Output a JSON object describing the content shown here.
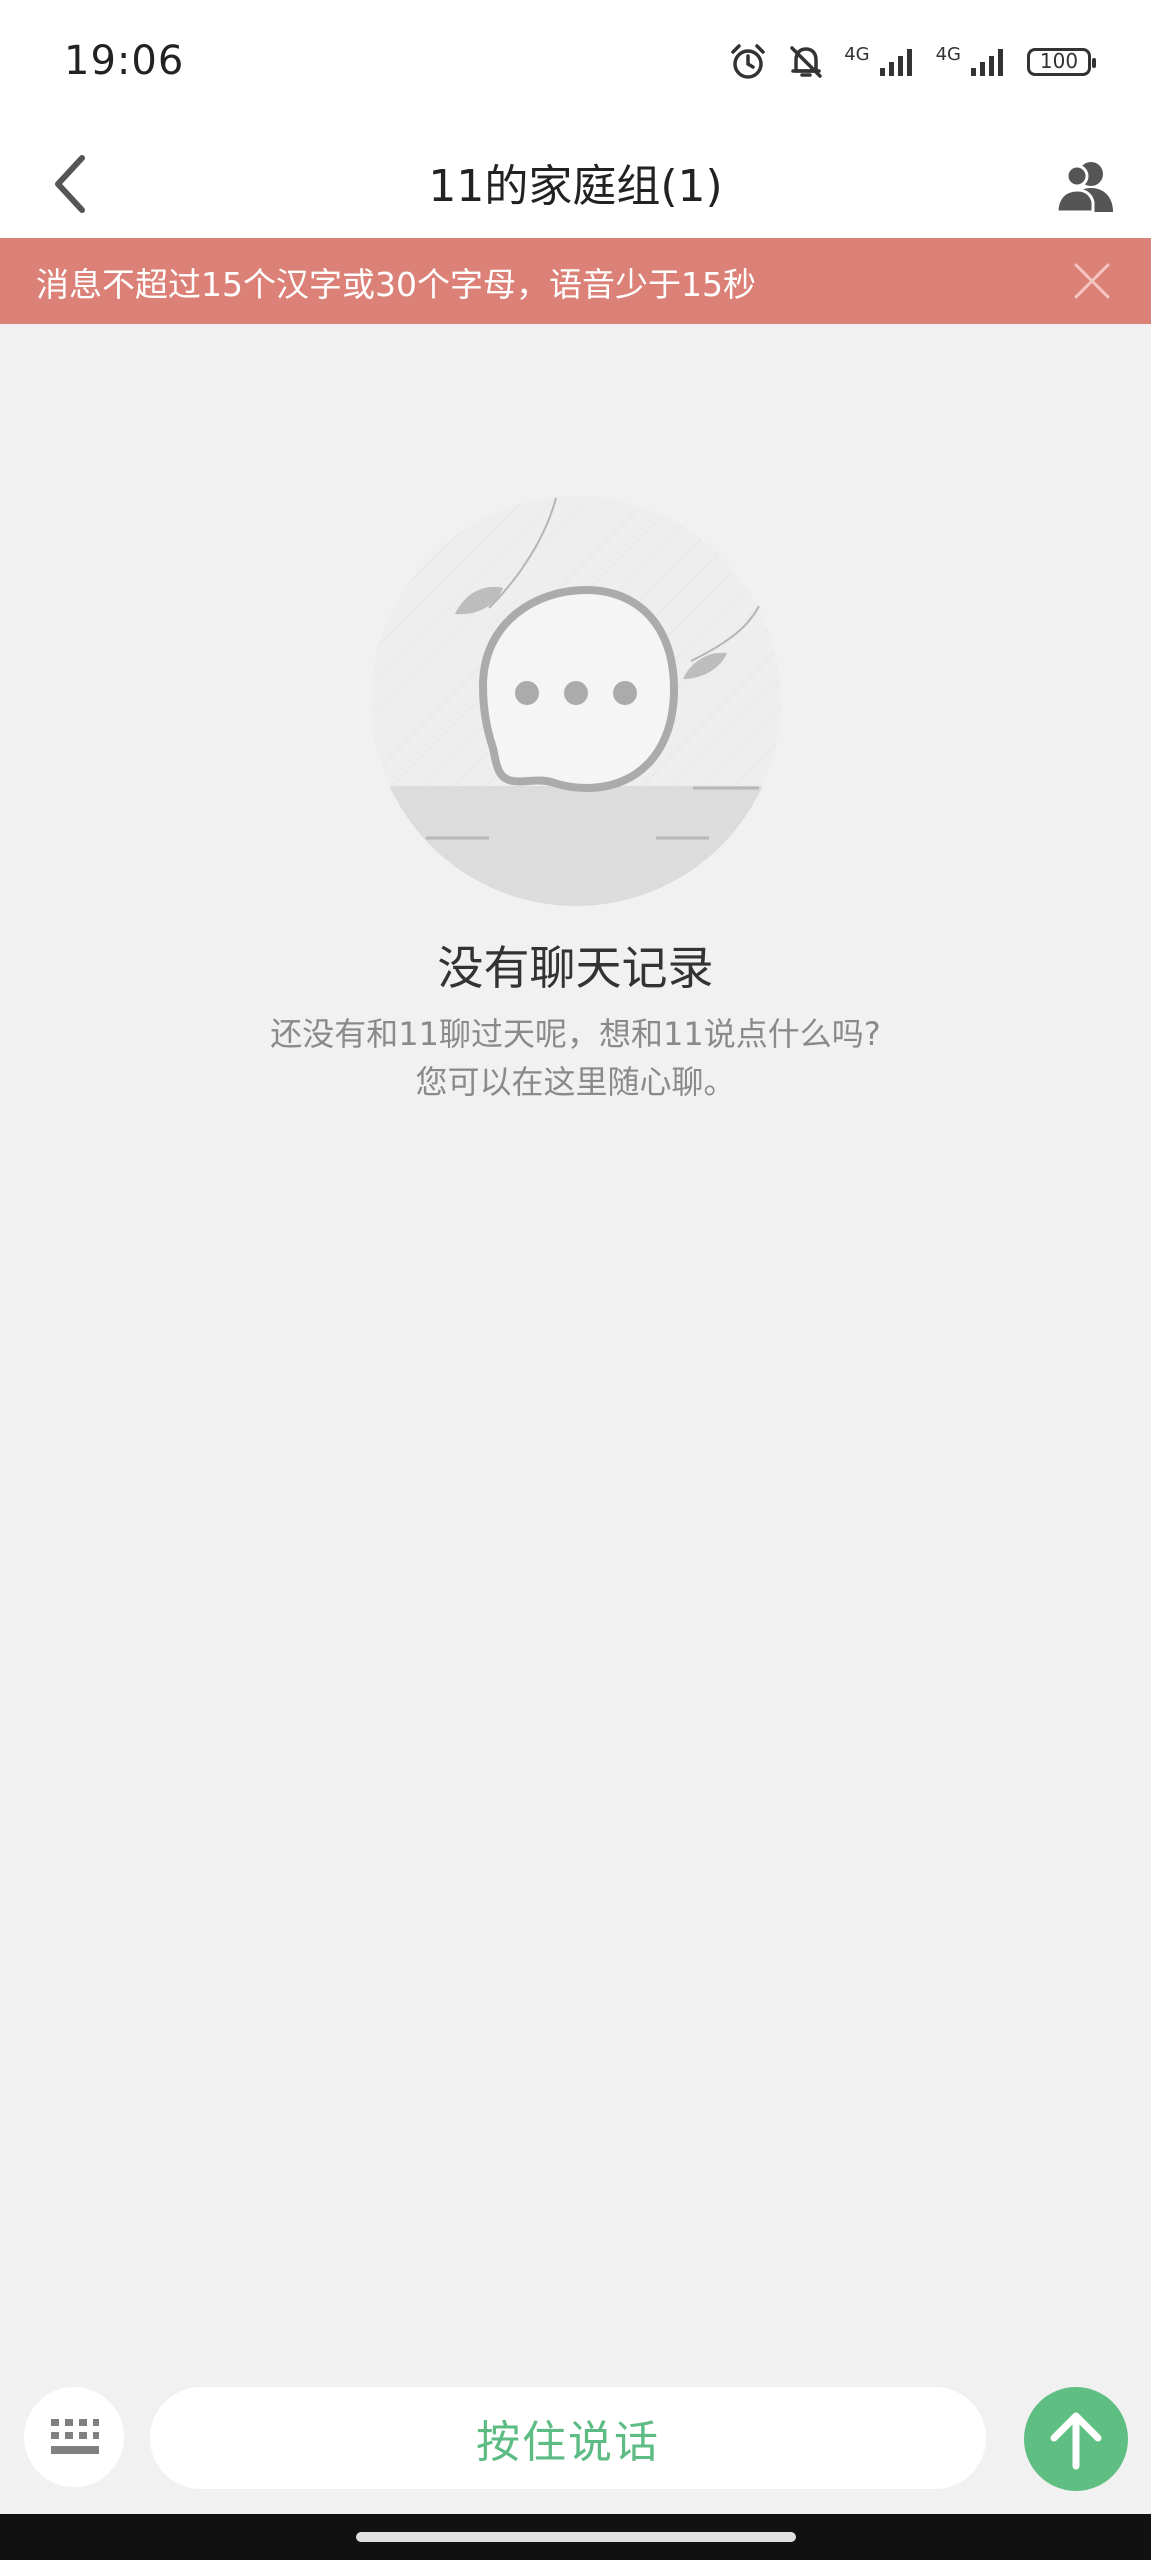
{
  "status_bar": {
    "time": "19:06",
    "network_1": "4G",
    "network_2": "4G",
    "battery": "100",
    "icons": [
      "alarm-icon",
      "bell-off-icon",
      "signal-icon",
      "signal-icon",
      "battery-icon"
    ]
  },
  "header": {
    "title": "11的家庭组(1)",
    "back_icon": "chevron-left-icon",
    "members_icon": "group-members-icon"
  },
  "notice": {
    "text": "消息不超过15个汉字或30个字母，语音少于15秒",
    "background": "#dc8177"
  },
  "empty_state": {
    "title": "没有聊天记录",
    "description_line1": "还没有和11聊过天呢，想和11说点什么吗?",
    "description_line2": "您可以在这里随心聊。"
  },
  "input_bar": {
    "keyboard_icon": "keyboard-icon",
    "hold_to_talk_label": "按住说话",
    "send_icon": "arrow-up-icon",
    "accent": "#5fbf83"
  }
}
